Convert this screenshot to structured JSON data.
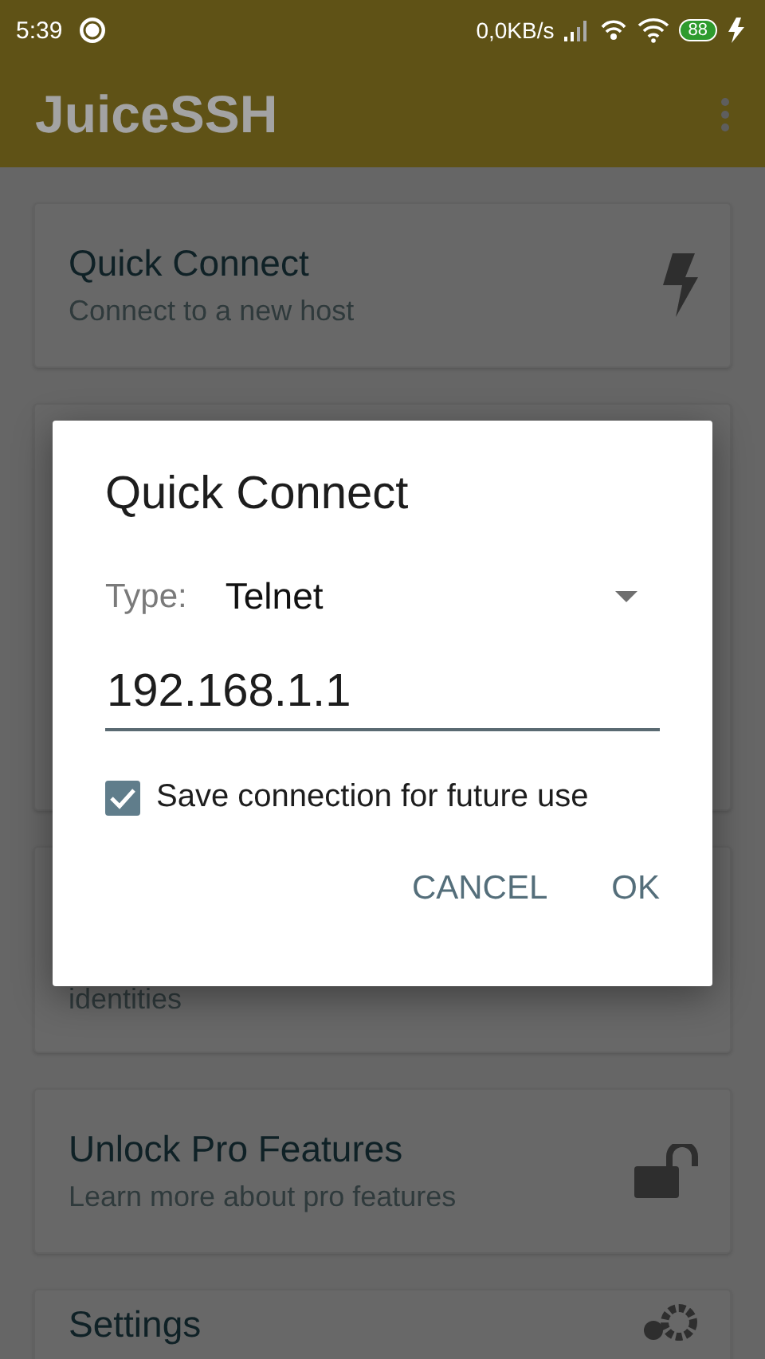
{
  "status_bar": {
    "time": "5:39",
    "net_speed": "0,0KB/s",
    "battery": "88"
  },
  "app_bar": {
    "title": "JuiceSSH"
  },
  "cards": [
    {
      "kind": "quick",
      "title": "Quick Connect",
      "subtitle": "Connect to a new host"
    },
    {
      "kind": "hidden"
    },
    {
      "kind": "tail",
      "subtitle": "identities"
    },
    {
      "kind": "unlock",
      "title": "Unlock Pro Features",
      "subtitle": "Learn more about pro features"
    },
    {
      "kind": "settings",
      "title": "Settings"
    }
  ],
  "dialog": {
    "title": "Quick Connect",
    "type_label": "Type:",
    "type_value": "Telnet",
    "address": "192.168.1.1",
    "save": {
      "label": "Save connection for future use",
      "checked": true
    },
    "buttons": [
      "CANCEL",
      "OK"
    ]
  }
}
